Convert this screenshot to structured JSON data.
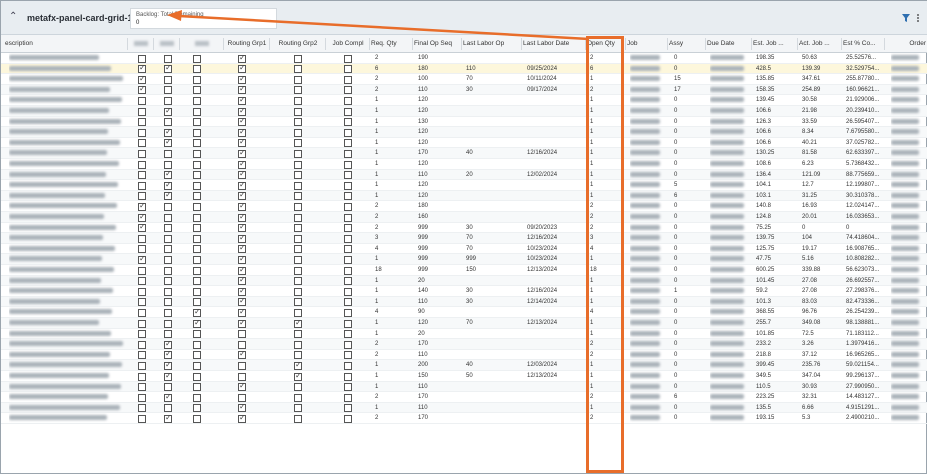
{
  "panel": {
    "title": "metafx-panel-card-grid-1",
    "tooltip_label": "Backlog: Total Remaining",
    "tooltip_value": "0"
  },
  "columns": [
    "escription",
    "",
    "",
    "",
    "Routing Grp1",
    "Routing Grp2",
    "Job Compl",
    "Req. Qty",
    "Final Op Seq",
    "Last Labor Op",
    "Last Labor Date",
    "Open Qty",
    "Job",
    "Assy",
    "Due Date",
    "Est. Job ...",
    "Act. Job ...",
    "Est % Co...",
    "Order"
  ],
  "colors": {
    "accent": "#e86d2a",
    "highlight_row": "#fdf7dc"
  },
  "rows": [
    {
      "c1": false,
      "c2": false,
      "c3": false,
      "rg1": true,
      "rg2": false,
      "jc": false,
      "req": "2",
      "fos": "190",
      "llo": "",
      "lld": "",
      "open": "2",
      "assy": "0",
      "est": "198.35",
      "act": "50.63",
      "pct": "25.52576..."
    },
    {
      "c1": true,
      "c2": true,
      "c3": false,
      "rg1": true,
      "rg2": false,
      "jc": false,
      "req": "6",
      "fos": "180",
      "llo": "110",
      "lld": "09/25/2024",
      "open": "6",
      "assy": "0",
      "est": "428.5",
      "act": "139.39",
      "pct": "32.529754..."
    },
    {
      "c1": true,
      "c2": false,
      "c3": false,
      "rg1": true,
      "rg2": false,
      "jc": false,
      "req": "2",
      "fos": "100",
      "llo": "70",
      "lld": "10/11/2024",
      "open": "1",
      "assy": "15",
      "est": "135.85",
      "act": "347.61",
      "pct": "255.87780..."
    },
    {
      "c1": true,
      "c2": false,
      "c3": false,
      "rg1": true,
      "rg2": false,
      "jc": false,
      "req": "2",
      "fos": "110",
      "llo": "30",
      "lld": "09/17/2024",
      "open": "2",
      "assy": "17",
      "est": "158.35",
      "act": "254.89",
      "pct": "160.96621..."
    },
    {
      "c1": false,
      "c2": false,
      "c3": false,
      "rg1": true,
      "rg2": false,
      "jc": false,
      "req": "1",
      "fos": "120",
      "llo": "",
      "lld": "",
      "open": "1",
      "assy": "0",
      "est": "139.45",
      "act": "30.58",
      "pct": "21.929006..."
    },
    {
      "c1": false,
      "c2": true,
      "c3": false,
      "rg1": true,
      "rg2": false,
      "jc": false,
      "req": "1",
      "fos": "120",
      "llo": "",
      "lld": "",
      "open": "1",
      "assy": "0",
      "est": "106.6",
      "act": "21.98",
      "pct": "20.239410..."
    },
    {
      "c1": false,
      "c2": false,
      "c3": false,
      "rg1": true,
      "rg2": false,
      "jc": false,
      "req": "1",
      "fos": "130",
      "llo": "",
      "lld": "",
      "open": "1",
      "assy": "0",
      "est": "126.3",
      "act": "33.59",
      "pct": "26.595407..."
    },
    {
      "c1": false,
      "c2": true,
      "c3": false,
      "rg1": true,
      "rg2": false,
      "jc": false,
      "req": "1",
      "fos": "120",
      "llo": "",
      "lld": "",
      "open": "1",
      "assy": "0",
      "est": "106.6",
      "act": "8.34",
      "pct": "7.6795580..."
    },
    {
      "c1": false,
      "c2": true,
      "c3": false,
      "rg1": true,
      "rg2": false,
      "jc": false,
      "req": "1",
      "fos": "120",
      "llo": "",
      "lld": "",
      "open": "1",
      "assy": "0",
      "est": "106.6",
      "act": "40.21",
      "pct": "37.025782..."
    },
    {
      "c1": false,
      "c2": false,
      "c3": false,
      "rg1": true,
      "rg2": false,
      "jc": false,
      "req": "1",
      "fos": "170",
      "llo": "40",
      "lld": "12/16/2024",
      "open": "1",
      "assy": "0",
      "est": "130.25",
      "act": "81.58",
      "pct": "62.633397..."
    },
    {
      "c1": false,
      "c2": false,
      "c3": false,
      "rg1": true,
      "rg2": false,
      "jc": false,
      "req": "1",
      "fos": "120",
      "llo": "",
      "lld": "",
      "open": "1",
      "assy": "0",
      "est": "108.6",
      "act": "6.23",
      "pct": "5.7368432..."
    },
    {
      "c1": false,
      "c2": true,
      "c3": false,
      "rg1": true,
      "rg2": false,
      "jc": false,
      "req": "1",
      "fos": "110",
      "llo": "20",
      "lld": "12/02/2024",
      "open": "1",
      "assy": "0",
      "est": "136.4",
      "act": "121.09",
      "pct": "88.775659..."
    },
    {
      "c1": false,
      "c2": true,
      "c3": false,
      "rg1": true,
      "rg2": false,
      "jc": false,
      "req": "1",
      "fos": "120",
      "llo": "",
      "lld": "",
      "open": "1",
      "assy": "5",
      "est": "104.1",
      "act": "12.7",
      "pct": "12.199807..."
    },
    {
      "c1": false,
      "c2": true,
      "c3": false,
      "rg1": true,
      "rg2": false,
      "jc": false,
      "req": "1",
      "fos": "120",
      "llo": "",
      "lld": "",
      "open": "1",
      "assy": "6",
      "est": "103.1",
      "act": "31.25",
      "pct": "30.310378..."
    },
    {
      "c1": true,
      "c2": false,
      "c3": false,
      "rg1": true,
      "rg2": false,
      "jc": false,
      "req": "2",
      "fos": "180",
      "llo": "",
      "lld": "",
      "open": "2",
      "assy": "0",
      "est": "140.8",
      "act": "16.93",
      "pct": "12.024147..."
    },
    {
      "c1": true,
      "c2": false,
      "c3": false,
      "rg1": true,
      "rg2": false,
      "jc": false,
      "req": "2",
      "fos": "160",
      "llo": "",
      "lld": "",
      "open": "2",
      "assy": "0",
      "est": "124.8",
      "act": "20.01",
      "pct": "16.033653..."
    },
    {
      "c1": true,
      "c2": false,
      "c3": false,
      "rg1": true,
      "rg2": false,
      "jc": false,
      "req": "2",
      "fos": "999",
      "llo": "30",
      "lld": "09/20/2023",
      "open": "2",
      "assy": "0",
      "est": "75.25",
      "act": "0",
      "pct": "0"
    },
    {
      "c1": false,
      "c2": false,
      "c3": false,
      "rg1": true,
      "rg2": false,
      "jc": false,
      "req": "3",
      "fos": "999",
      "llo": "70",
      "lld": "12/16/2024",
      "open": "3",
      "assy": "0",
      "est": "139.75",
      "act": "104",
      "pct": "74.418604..."
    },
    {
      "c1": false,
      "c2": false,
      "c3": false,
      "rg1": true,
      "rg2": false,
      "jc": false,
      "req": "4",
      "fos": "999",
      "llo": "70",
      "lld": "10/23/2024",
      "open": "4",
      "assy": "0",
      "est": "125.75",
      "act": "19.17",
      "pct": "16.908765..."
    },
    {
      "c1": true,
      "c2": false,
      "c3": false,
      "rg1": true,
      "rg2": false,
      "jc": false,
      "req": "1",
      "fos": "999",
      "llo": "999",
      "lld": "10/23/2024",
      "open": "1",
      "assy": "0",
      "est": "47.75",
      "act": "5.16",
      "pct": "10.808282..."
    },
    {
      "c1": false,
      "c2": false,
      "c3": false,
      "rg1": true,
      "rg2": false,
      "jc": false,
      "req": "18",
      "fos": "999",
      "llo": "150",
      "lld": "12/13/2024",
      "open": "18",
      "assy": "0",
      "est": "600.25",
      "act": "339.88",
      "pct": "56.623073..."
    },
    {
      "c1": false,
      "c2": false,
      "c3": false,
      "rg1": true,
      "rg2": false,
      "jc": false,
      "req": "1",
      "fos": "20",
      "llo": "",
      "lld": "",
      "open": "1",
      "assy": "0",
      "est": "101.45",
      "act": "27.08",
      "pct": "26.692557..."
    },
    {
      "c1": false,
      "c2": false,
      "c3": false,
      "rg1": true,
      "rg2": false,
      "jc": false,
      "req": "1",
      "fos": "140",
      "llo": "30",
      "lld": "12/16/2024",
      "open": "1",
      "assy": "1",
      "est": "59.2",
      "act": "27.08",
      "pct": "27.298376..."
    },
    {
      "c1": false,
      "c2": false,
      "c3": false,
      "rg1": true,
      "rg2": false,
      "jc": false,
      "req": "1",
      "fos": "110",
      "llo": "30",
      "lld": "12/14/2024",
      "open": "1",
      "assy": "0",
      "est": "101.3",
      "act": "83.03",
      "pct": "82.473336..."
    },
    {
      "c1": false,
      "c2": false,
      "c3": true,
      "rg1": true,
      "rg2": false,
      "jc": false,
      "req": "4",
      "fos": "90",
      "llo": "",
      "lld": "",
      "open": "4",
      "assy": "0",
      "est": "368.55",
      "act": "96.76",
      "pct": "26.254239..."
    },
    {
      "c1": false,
      "c2": false,
      "c3": true,
      "rg1": true,
      "rg2": true,
      "jc": false,
      "req": "1",
      "fos": "120",
      "llo": "70",
      "lld": "12/13/2024",
      "open": "1",
      "assy": "0",
      "est": "255.7",
      "act": "349.08",
      "pct": "98.138881..."
    },
    {
      "c1": false,
      "c2": false,
      "c3": false,
      "rg1": false,
      "rg2": false,
      "jc": false,
      "req": "1",
      "fos": "20",
      "llo": "",
      "lld": "",
      "open": "1",
      "assy": "0",
      "est": "101.85",
      "act": "72.5",
      "pct": "71.183112..."
    },
    {
      "c1": false,
      "c2": true,
      "c3": false,
      "rg1": false,
      "rg2": false,
      "jc": false,
      "req": "2",
      "fos": "170",
      "llo": "",
      "lld": "",
      "open": "2",
      "assy": "0",
      "est": "233.2",
      "act": "3.26",
      "pct": "1.3979416..."
    },
    {
      "c1": false,
      "c2": true,
      "c3": false,
      "rg1": true,
      "rg2": false,
      "jc": false,
      "req": "2",
      "fos": "110",
      "llo": "",
      "lld": "",
      "open": "2",
      "assy": "0",
      "est": "218.8",
      "act": "37.12",
      "pct": "16.965265..."
    },
    {
      "c1": false,
      "c2": true,
      "c3": false,
      "rg1": false,
      "rg2": true,
      "jc": false,
      "req": "1",
      "fos": "200",
      "llo": "40",
      "lld": "12/03/2024",
      "open": "1",
      "assy": "0",
      "est": "399.45",
      "act": "235.76",
      "pct": "59.021154..."
    },
    {
      "c1": false,
      "c2": true,
      "c3": false,
      "rg1": false,
      "rg2": true,
      "jc": false,
      "req": "1",
      "fos": "150",
      "llo": "50",
      "lld": "12/13/2024",
      "open": "1",
      "assy": "0",
      "est": "349.5",
      "act": "347.04",
      "pct": "99.296137..."
    },
    {
      "c1": false,
      "c2": false,
      "c3": false,
      "rg1": true,
      "rg2": false,
      "jc": false,
      "req": "1",
      "fos": "110",
      "llo": "",
      "lld": "",
      "open": "1",
      "assy": "0",
      "est": "110.5",
      "act": "30.93",
      "pct": "27.990950..."
    },
    {
      "c1": false,
      "c2": true,
      "c3": false,
      "rg1": false,
      "rg2": false,
      "jc": false,
      "req": "2",
      "fos": "170",
      "llo": "",
      "lld": "",
      "open": "2",
      "assy": "6",
      "est": "223.25",
      "act": "32.31",
      "pct": "14.483127..."
    },
    {
      "c1": false,
      "c2": false,
      "c3": false,
      "rg1": true,
      "rg2": false,
      "jc": false,
      "req": "1",
      "fos": "110",
      "llo": "",
      "lld": "",
      "open": "1",
      "assy": "0",
      "est": "135.5",
      "act": "6.66",
      "pct": "4.9151291..."
    },
    {
      "c1": false,
      "c2": true,
      "c3": false,
      "rg1": true,
      "rg2": false,
      "jc": false,
      "req": "2",
      "fos": "170",
      "llo": "",
      "lld": "",
      "open": "2",
      "assy": "0",
      "est": "193.15",
      "act": "5.3",
      "pct": "2.4900210..."
    }
  ]
}
